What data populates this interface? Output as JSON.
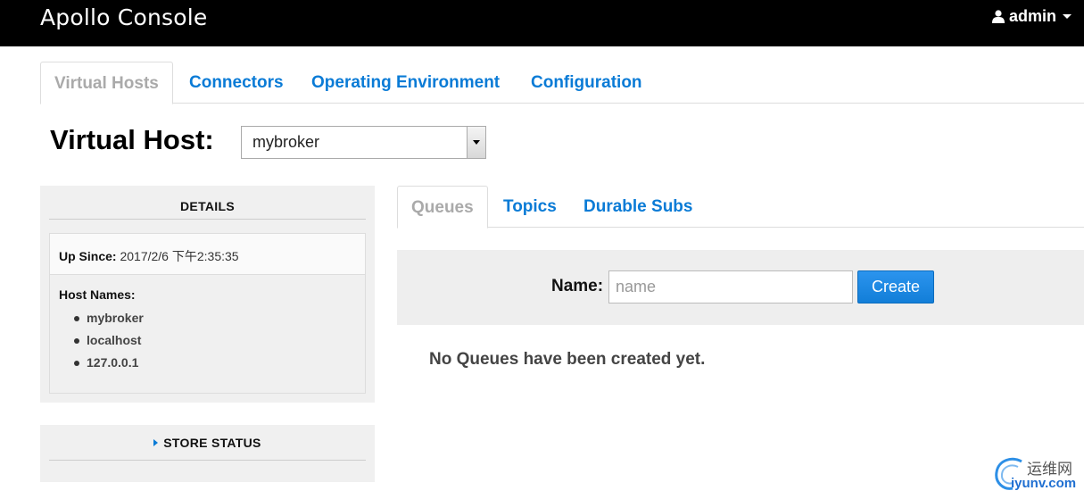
{
  "header": {
    "brand": "Apollo Console",
    "user": "admin"
  },
  "main_tabs": [
    {
      "label": "Virtual Hosts",
      "active": true
    },
    {
      "label": "Connectors",
      "active": false
    },
    {
      "label": "Operating Environment",
      "active": false
    },
    {
      "label": "Configuration",
      "active": false
    }
  ],
  "virtual_host": {
    "label": "Virtual Host:",
    "selected": "mybroker"
  },
  "details": {
    "title": "DETAILS",
    "up_since_label": "Up Since:",
    "up_since_value": "2017/2/6 下午2:35:35",
    "host_names_label": "Host Names:",
    "host_names": [
      "mybroker",
      "localhost",
      "127.0.0.1"
    ]
  },
  "store_status": {
    "title": "STORE STATUS"
  },
  "sub_tabs": [
    {
      "label": "Queues",
      "active": true
    },
    {
      "label": "Topics",
      "active": false
    },
    {
      "label": "Durable Subs",
      "active": false
    }
  ],
  "create_form": {
    "name_label": "Name:",
    "placeholder": "name",
    "value": "",
    "button_label": "Create"
  },
  "empty_message": "No Queues have been created yet.",
  "watermark": {
    "cn": "运维网",
    "en": "iyunv.com"
  },
  "colors": {
    "topbar": "#000000",
    "link": "#0a7bd6",
    "button": "#1a86e0",
    "panel": "#f0f0f0"
  }
}
